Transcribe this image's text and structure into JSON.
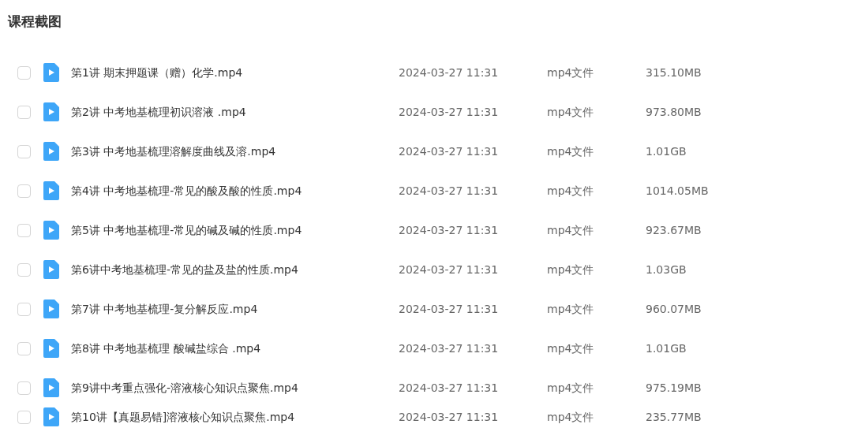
{
  "title": "课程截图",
  "files": [
    {
      "name": "第1讲 期末押题课（赠）化学.mp4",
      "date": "2024-03-27 11:31",
      "type": "mp4文件",
      "size": "315.10MB",
      "checked": false
    },
    {
      "name": "第2讲 中考地基梳理初识溶液 .mp4",
      "date": "2024-03-27 11:31",
      "type": "mp4文件",
      "size": "973.80MB",
      "checked": false
    },
    {
      "name": "第3讲 中考地基梳理溶解度曲线及溶.mp4",
      "date": "2024-03-27 11:31",
      "type": "mp4文件",
      "size": "1.01GB",
      "checked": false
    },
    {
      "name": "第4讲 中考地基梳理-常见的酸及酸的性质.mp4",
      "date": "2024-03-27 11:31",
      "type": "mp4文件",
      "size": "1014.05MB",
      "checked": false
    },
    {
      "name": "第5讲 中考地基梳理-常见的碱及碱的性质.mp4",
      "date": "2024-03-27 11:31",
      "type": "mp4文件",
      "size": "923.67MB",
      "checked": false
    },
    {
      "name": "第6讲中考地基梳理-常见的盐及盐的性质.mp4",
      "date": "2024-03-27 11:31",
      "type": "mp4文件",
      "size": "1.03GB",
      "checked": false
    },
    {
      "name": "第7讲 中考地基梳理-复分解反应.mp4",
      "date": "2024-03-27 11:31",
      "type": "mp4文件",
      "size": "960.07MB",
      "checked": false
    },
    {
      "name": "第8讲 中考地基梳理 酸碱盐综合 .mp4",
      "date": "2024-03-27 11:31",
      "type": "mp4文件",
      "size": "1.01GB",
      "checked": false
    },
    {
      "name": "第9讲中考重点强化-溶液核心知识点聚焦.mp4",
      "date": "2024-03-27 11:31",
      "type": "mp4文件",
      "size": "975.19MB",
      "checked": false
    },
    {
      "name": "第10讲【真题易错]溶液核心知识点聚焦.mp4",
      "date": "2024-03-27 11:31",
      "type": "mp4文件",
      "size": "235.77MB",
      "checked": false
    }
  ]
}
